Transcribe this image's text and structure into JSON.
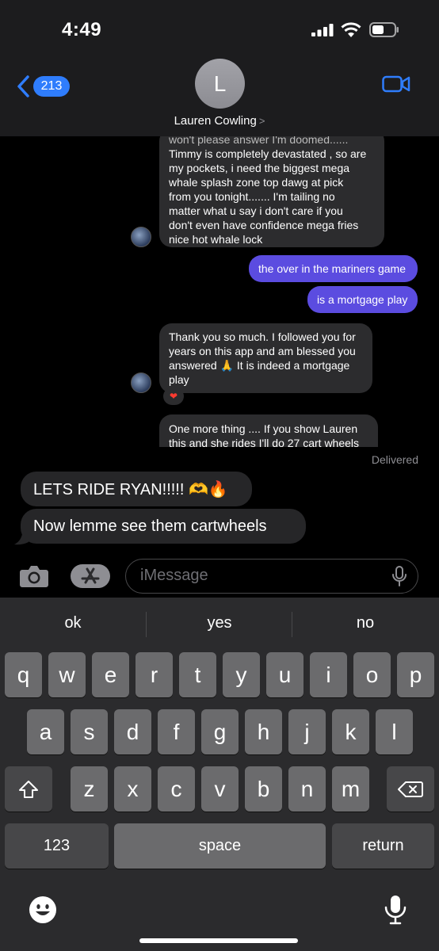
{
  "status_bar": {
    "time": "4:49"
  },
  "header": {
    "back_count": "213",
    "avatar_initial": "L",
    "contact_name": "Lauren Cowling",
    "contact_chevron": ">"
  },
  "embedded_screenshot": {
    "incoming_1": [
      "won't please answer I'm doomed......",
      "Timmy is completely devastated , so are",
      "my pockets,  i need the biggest mega",
      "whale splash zone top dawg at pick",
      "from you tonight....... I'm tailing no",
      "matter what u say i don't care if you",
      "don't even have confidence mega fries",
      "nice hot whale lock"
    ],
    "outgoing_1": "the over in the mariners game",
    "outgoing_2": "is a mortgage play",
    "incoming_2": [
      "Thank you so much. I followed you for",
      "years on this app and am blessed you",
      "answered 🙏 It is indeed a mortgage",
      "play"
    ],
    "reaction": "❤",
    "incoming_3": [
      "One more thing .... If you show Lauren",
      "this and she rides I'll do 27 cart wheels"
    ]
  },
  "delivered_label": "Delivered",
  "messages": [
    {
      "text": "LETS RIDE RYAN!!!!! 🫶🔥"
    },
    {
      "text": "Now lemme see them cartwheels"
    }
  ],
  "input": {
    "placeholder": "iMessage"
  },
  "keyboard": {
    "suggestions": [
      "ok",
      "yes",
      "no"
    ],
    "row1": [
      "q",
      "w",
      "e",
      "r",
      "t",
      "y",
      "u",
      "i",
      "o",
      "p"
    ],
    "row2": [
      "a",
      "s",
      "d",
      "f",
      "g",
      "h",
      "j",
      "k",
      "l"
    ],
    "row3": [
      "z",
      "x",
      "c",
      "v",
      "b",
      "n",
      "m"
    ],
    "numbers_label": "123",
    "space_label": "space",
    "return_label": "return"
  }
}
